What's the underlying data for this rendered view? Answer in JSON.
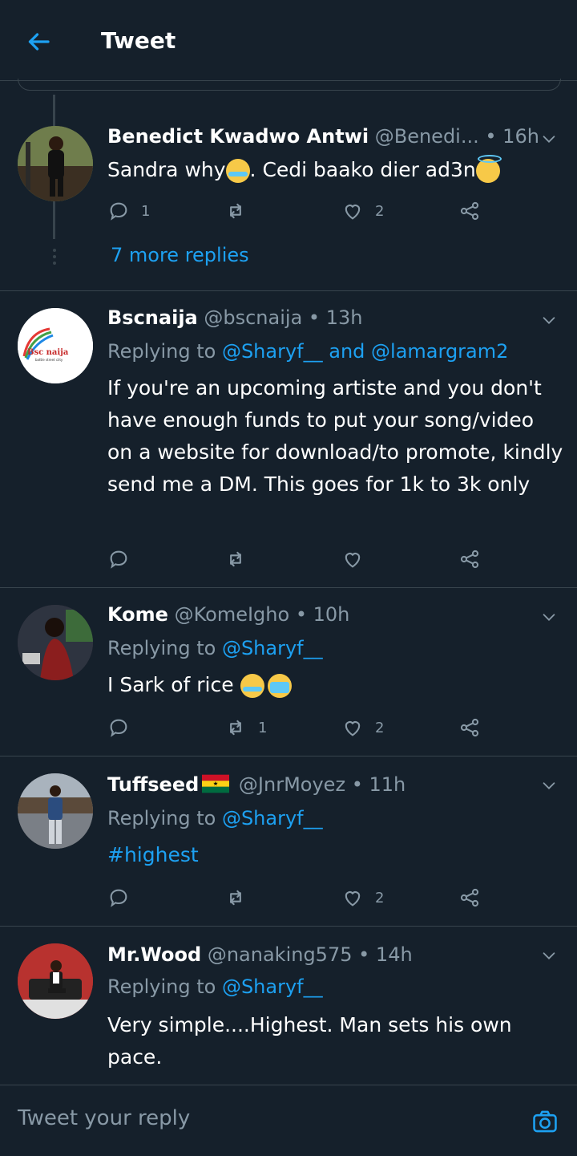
{
  "header": {
    "title": "Tweet"
  },
  "tweets": [
    {
      "name": "Benedict Kwadwo Antwi",
      "handle": "@Benedi...",
      "time": "16h",
      "text": "Sandra why",
      "text2": ". Cedi baako dier ad3n",
      "replies": "1",
      "retweets": "",
      "likes": "2",
      "more_replies": "7 more replies"
    },
    {
      "name": "Bscnaija",
      "handle": "@bscnaija",
      "time": "13h",
      "replying_prefix": "Replying to ",
      "mention1": "@Sharyf__",
      "and": " and ",
      "mention2": "@lamargram2",
      "text": "If you're an upcoming artiste and you don't have enough funds to put your song/video on a website for download/to promote, kindly send me a DM. This goes for 1k to 3k only",
      "replies": "",
      "retweets": "",
      "likes": "",
      "avatar_text": "Bsc naija",
      "avatar_sub": "battle street ciity"
    },
    {
      "name": "Kome",
      "handle": "@KomeIgho",
      "time": "10h",
      "replying_prefix": "Replying to ",
      "mention1": "@Sharyf__",
      "text": "I Sark of rice ",
      "replies": "",
      "retweets": "1",
      "likes": "2"
    },
    {
      "name": "Tuffseed",
      "handle": "@JnrMoyez",
      "time": "11h",
      "replying_prefix": "Replying to ",
      "mention1": "@Sharyf__",
      "text": "#highest",
      "replies": "",
      "retweets": "",
      "likes": "2"
    },
    {
      "name": "Mr.Wood",
      "handle": "@nanaking575",
      "time": "14h",
      "replying_prefix": "Replying to ",
      "mention1": "@Sharyf__",
      "text": "Very simple....Highest. Man sets his own pace.",
      "replies": "",
      "retweets": "",
      "likes": ""
    }
  ],
  "composer": {
    "placeholder": "Tweet your reply"
  },
  "sep": " • ",
  "colors": {
    "background": "#15202b",
    "accent": "#1da1f2",
    "muted": "#8899a6",
    "divider": "#38444d"
  }
}
